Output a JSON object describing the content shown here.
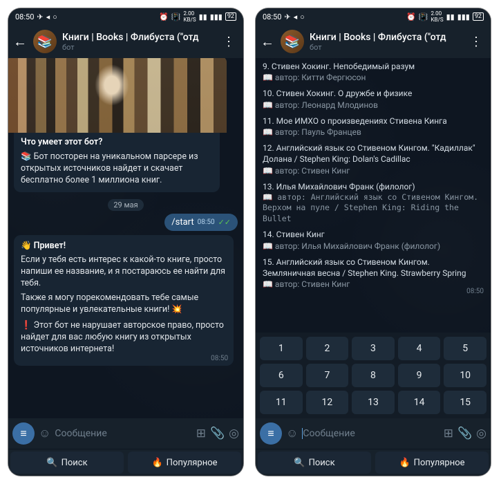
{
  "status": {
    "time": "08:50",
    "right": "92"
  },
  "header": {
    "title": "Книги | Books | Флибуста (\"отд",
    "subtitle": "бот"
  },
  "left": {
    "card_title": "Что умеет этот бот?",
    "card_text": "📚 Бот посторен на уникальном парсере из открытых источников найдет и скачает бесплатно более 1 миллиона книг.",
    "date": "29 мая",
    "out_msg": "/start",
    "out_time": "08:50",
    "greeting_title": "👋 Привет!",
    "greeting_p1": "Если у тебя есть интерес к какой-то книге, просто напиши ее название, и я постараюсь ее найти для тебя.",
    "greeting_p2": "Также я могу порекомендовать тебе самые популярные и увлекательные книги! 💥",
    "greeting_p3": "❗ Этот бот не нарушает авторское право, просто найдет для вас любую книгу из открытых источников интернета!",
    "greeting_time": "08:50"
  },
  "right": {
    "items": [
      {
        "num": "9.",
        "title": "Стивен Хокинг. Непобедимый разум",
        "author": "Китти Фергюсон"
      },
      {
        "num": "10.",
        "title": "Стивен Хокинг. О дружбе и физике",
        "author": "Леонард Млодинов"
      },
      {
        "num": "11.",
        "title": "Мое ИМХО о произведениях Стивена Кинга",
        "author": "Пауль Францев"
      },
      {
        "num": "12.",
        "title": "Английский язык со Стивеном Кингом. \"Кадиллак\" Долана / Stephen King: Dolan's Cadillac",
        "author": "Стивен Кинг"
      },
      {
        "num": "13.",
        "title": "Илья Михайлович Франк (филолог)",
        "author": "Английский язык со Стивеном Кингом. Верхом на пуле / Stephen King: Riding the Bullet",
        "mono": true
      },
      {
        "num": "14.",
        "title": "Стивен Кинг",
        "author": "Илья Михайлович Франк (филолог)"
      },
      {
        "num": "15.",
        "title": "Английский язык со Стивеном Кингом. Земляничная весна / Stephen King. Strawberry Spring",
        "author": "Стивен Кинг"
      }
    ],
    "list_time": "08:50",
    "keys": [
      "1",
      "2",
      "3",
      "4",
      "5",
      "6",
      "7",
      "8",
      "9",
      "10",
      "11",
      "12",
      "13",
      "14",
      "15"
    ]
  },
  "input": {
    "placeholder": "Сообщение"
  },
  "buttons": {
    "search": "Поиск",
    "popular": "Популярное"
  }
}
